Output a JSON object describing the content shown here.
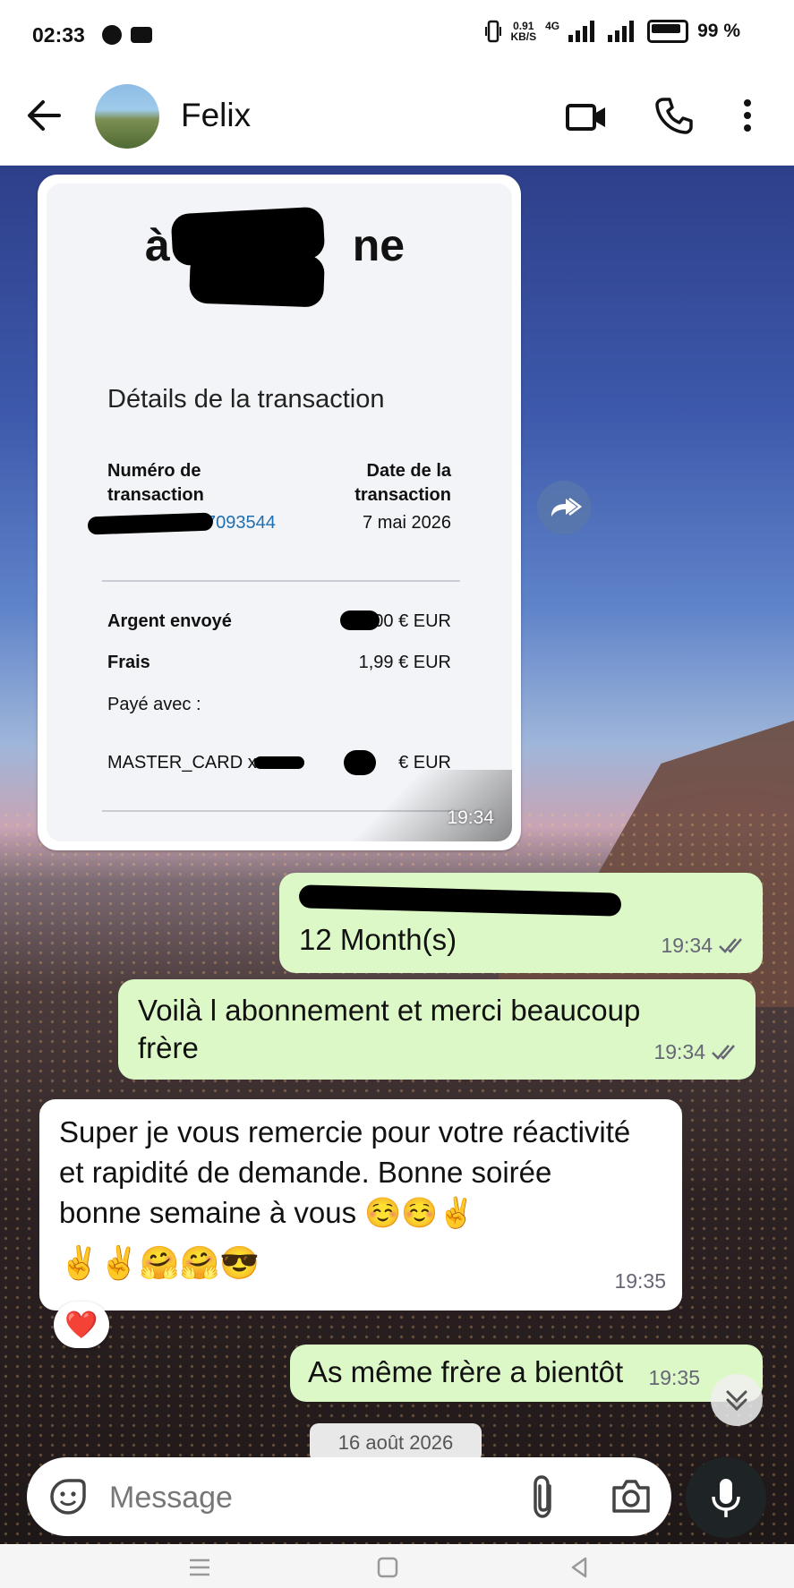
{
  "status_bar": {
    "time": "02:33",
    "net_speed_value": "0.91",
    "net_speed_unit": "KB/S",
    "network": "4G",
    "battery": "99 %"
  },
  "header": {
    "contact_name": "Felix"
  },
  "receipt": {
    "heading": "à",
    "heading_tail": "ne",
    "title": "Détails de la transaction",
    "tx_number_label_1": "Numéro de",
    "tx_number_label_2": "transaction",
    "tx_number_value": "7093544",
    "tx_date_label_1": "Date de la",
    "tx_date_label_2": "transaction",
    "tx_date_value": "7 mai 2026",
    "sent_label": "Argent envoyé",
    "sent_value": "00 € EUR",
    "fees_label": "Frais",
    "fees_value": "1,99 € EUR",
    "paid_with_label": "Payé avec :",
    "card_label": "MASTER_CARD x",
    "card_value": "€ EUR",
    "time": "19:34"
  },
  "messages": [
    {
      "direction": "out",
      "text": "12 Month(s)",
      "time": "19:34"
    },
    {
      "direction": "out",
      "text": "Voilà l abonnement et merci beaucoup frère",
      "time": "19:34"
    },
    {
      "direction": "in",
      "text": "Super je vous remercie pour votre réactivité et rapidité de demande. Bonne soirée bonne semaine à vous",
      "emoji_line_1": "☺️☺️✌️",
      "emoji_line_2": "✌️✌️🤗🤗😎",
      "time": "19:35",
      "reaction": "❤️"
    },
    {
      "direction": "out",
      "text": "As même frère a bientôt",
      "time": "19:35"
    }
  ],
  "date_separator": "16 août 2026",
  "composer": {
    "placeholder": "Message"
  },
  "colors": {
    "outgoing_bubble": "#dbf8c6",
    "incoming_bubble": "#ffffff",
    "link": "#1f6fb0"
  }
}
